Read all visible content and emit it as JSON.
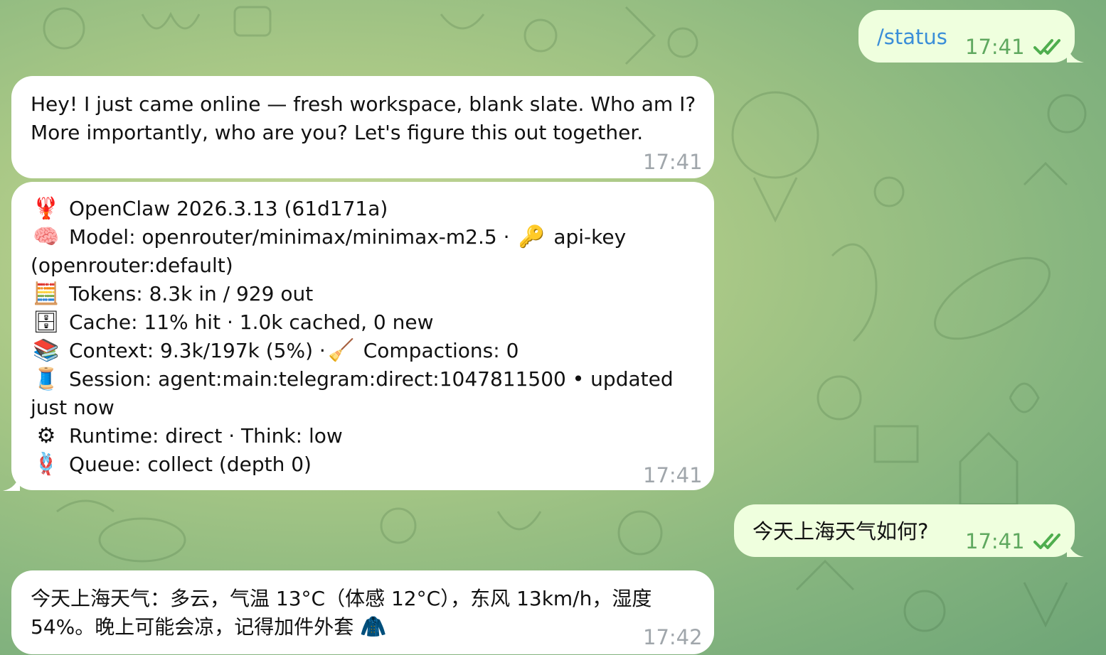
{
  "chat": {
    "messages": [
      {
        "id": "m1",
        "direction": "out",
        "text": "/status",
        "time": "17:41",
        "read": true
      },
      {
        "id": "m2",
        "direction": "in",
        "text": "Hey! I just came online — fresh workspace, blank slate. Who am I? More importantly, who are you? Let's figure this out together.",
        "time": "17:41"
      },
      {
        "id": "m3",
        "direction": "in",
        "time": "17:41",
        "lines": [
          {
            "icon": "lobster-icon",
            "glyph": "🦞",
            "text": "OpenClaw 2026.3.13 (61d171a)"
          },
          {
            "icon": "brain-icon",
            "glyph": "🧠",
            "text": "Model: openrouter/minimax/minimax-m2.5 · ",
            "icon2": "key-icon",
            "glyph2": "🔑",
            "text2": " api-key (openrouter:default)"
          },
          {
            "icon": "abacus-icon",
            "glyph": "🧮",
            "text": "Tokens: 8.3k in / 929 out"
          },
          {
            "icon": "file-cabinet-icon",
            "glyph": "🗄",
            "text": "Cache: 11% hit · 1.0k cached, 0 new"
          },
          {
            "icon": "books-icon",
            "glyph": "📚",
            "text": "Context: 9.3k/197k (5%) · ",
            "icon2": "broom-icon",
            "glyph2": "🧹",
            "text2": " Compactions: 0"
          },
          {
            "icon": "thread-spool-icon",
            "glyph": "🧵",
            "text": "Session: agent:main:telegram:direct:1047811500 • updated just now"
          },
          {
            "icon": "gear-icon",
            "glyph": "⚙",
            "text": "Runtime: direct · Think: low"
          },
          {
            "icon": "knot-icon",
            "glyph": "🪢",
            "text": "Queue: collect (depth 0)"
          }
        ]
      },
      {
        "id": "m4",
        "direction": "out",
        "text": "今天上海天气如何?",
        "time": "17:41",
        "read": true
      },
      {
        "id": "m5",
        "direction": "in",
        "text": "今天上海天气：多云，气温 13°C（体感 12°C），东风 13km/h，湿度 54%。晚上可能会凉，记得加件外套",
        "icon": "coat-icon",
        "glyph": "🧥",
        "time": "17:42"
      }
    ]
  },
  "colors": {
    "incoming_bubble": "#ffffff",
    "outgoing_bubble": "#efffde",
    "outgoing_time": "#5fa85f",
    "incoming_time": "#a0a6ab",
    "command_link": "#3a8ed8"
  }
}
